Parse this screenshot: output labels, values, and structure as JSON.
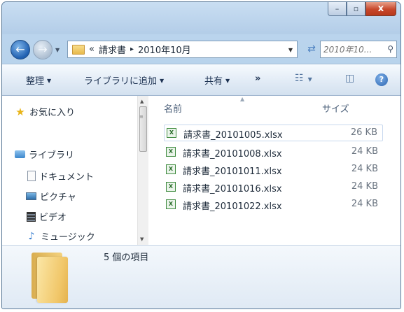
{
  "window": {
    "controls": {
      "minimize": "–",
      "maximize": "▫",
      "close": "x"
    }
  },
  "nav": {
    "back_icon": "back-arrow-icon",
    "forward_icon": "forward-arrow-icon",
    "breadcrumb": {
      "prefix": "«",
      "parent": "請求書",
      "separator": "▸",
      "current": "2010年10月"
    },
    "search_placeholder": "2010年10..."
  },
  "toolbar": {
    "organize": "整理",
    "add_to_library": "ライブラリに追加",
    "share": "共有",
    "more": "»"
  },
  "sidebar": {
    "favorites": "お気に入り",
    "libraries": "ライブラリ",
    "items": [
      {
        "label": "ドキュメント",
        "icon": "document-icon"
      },
      {
        "label": "ピクチャ",
        "icon": "picture-icon"
      },
      {
        "label": "ビデオ",
        "icon": "video-icon"
      },
      {
        "label": "ミュージック",
        "icon": "music-icon"
      }
    ]
  },
  "files": {
    "columns": {
      "name": "名前",
      "size": "サイズ"
    },
    "rows": [
      {
        "name": "請求書_20101005.xlsx",
        "size": "26 KB",
        "selected": true
      },
      {
        "name": "請求書_20101008.xlsx",
        "size": "24 KB",
        "selected": false
      },
      {
        "name": "請求書_20101011.xlsx",
        "size": "24 KB",
        "selected": false
      },
      {
        "name": "請求書_20101016.xlsx",
        "size": "24 KB",
        "selected": false
      },
      {
        "name": "請求書_20101022.xlsx",
        "size": "24 KB",
        "selected": false
      }
    ]
  },
  "details": {
    "item_count": "5 個の項目"
  },
  "colors": {
    "title_bar": "#bcd6ee",
    "close_button": "#c7472b",
    "folder": "#f1c76a",
    "selection_border": "#c8d8ee"
  }
}
